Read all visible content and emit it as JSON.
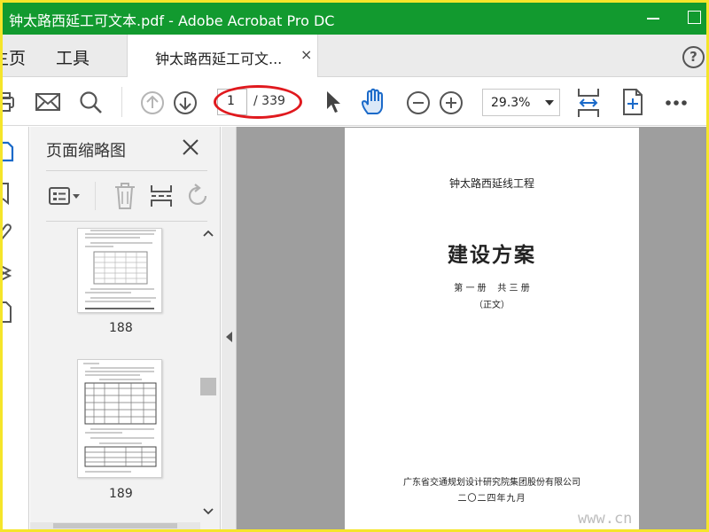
{
  "window": {
    "title": "钟太路西延工可文本.pdf - Adobe Acrobat Pro DC",
    "title_bar_color": "#129a2f"
  },
  "tabs": {
    "home_label": "主页",
    "tools_label": "工具",
    "document_tab_label": "钟太路西延工可文...",
    "close_glyph": "×",
    "help_glyph": "?"
  },
  "toolbar": {
    "current_page": "1",
    "page_total": "/ 339",
    "zoom_value": "29.3%",
    "icons": [
      "print-icon",
      "mail-icon",
      "search-icon",
      "page-up-icon",
      "page-down-icon",
      "select-arrow-icon",
      "hand-tool-icon",
      "zoom-out-icon",
      "zoom-in-icon",
      "fit-width-icon",
      "rotate-view-icon",
      "more-icon"
    ],
    "highlight_color": "#e0191e",
    "accent_color": "#1b6ac9"
  },
  "left_strip": {
    "icons": [
      "page-thumbnails-icon",
      "bookmark-icon",
      "attachment-icon",
      "layers-icon",
      "document-icon"
    ]
  },
  "thumbnail_panel": {
    "title": "页面缩略图",
    "close_glyph": "✕",
    "icons": [
      "thumbnail-options-icon",
      "delete-icon",
      "extract-icon",
      "rotate-icon"
    ],
    "thumbnails": [
      {
        "page_number": "188"
      },
      {
        "page_number": "189"
      }
    ]
  },
  "document": {
    "project_name": "钟太路西延线工程",
    "main_title": "建设方案",
    "volume_info": "第 一 册    共 三 册",
    "body_note": "（正文）",
    "organization": "广东省交通规划设计研究院集团股份有限公司",
    "date": "二〇二四年九月"
  },
  "watermark": "www.cn"
}
